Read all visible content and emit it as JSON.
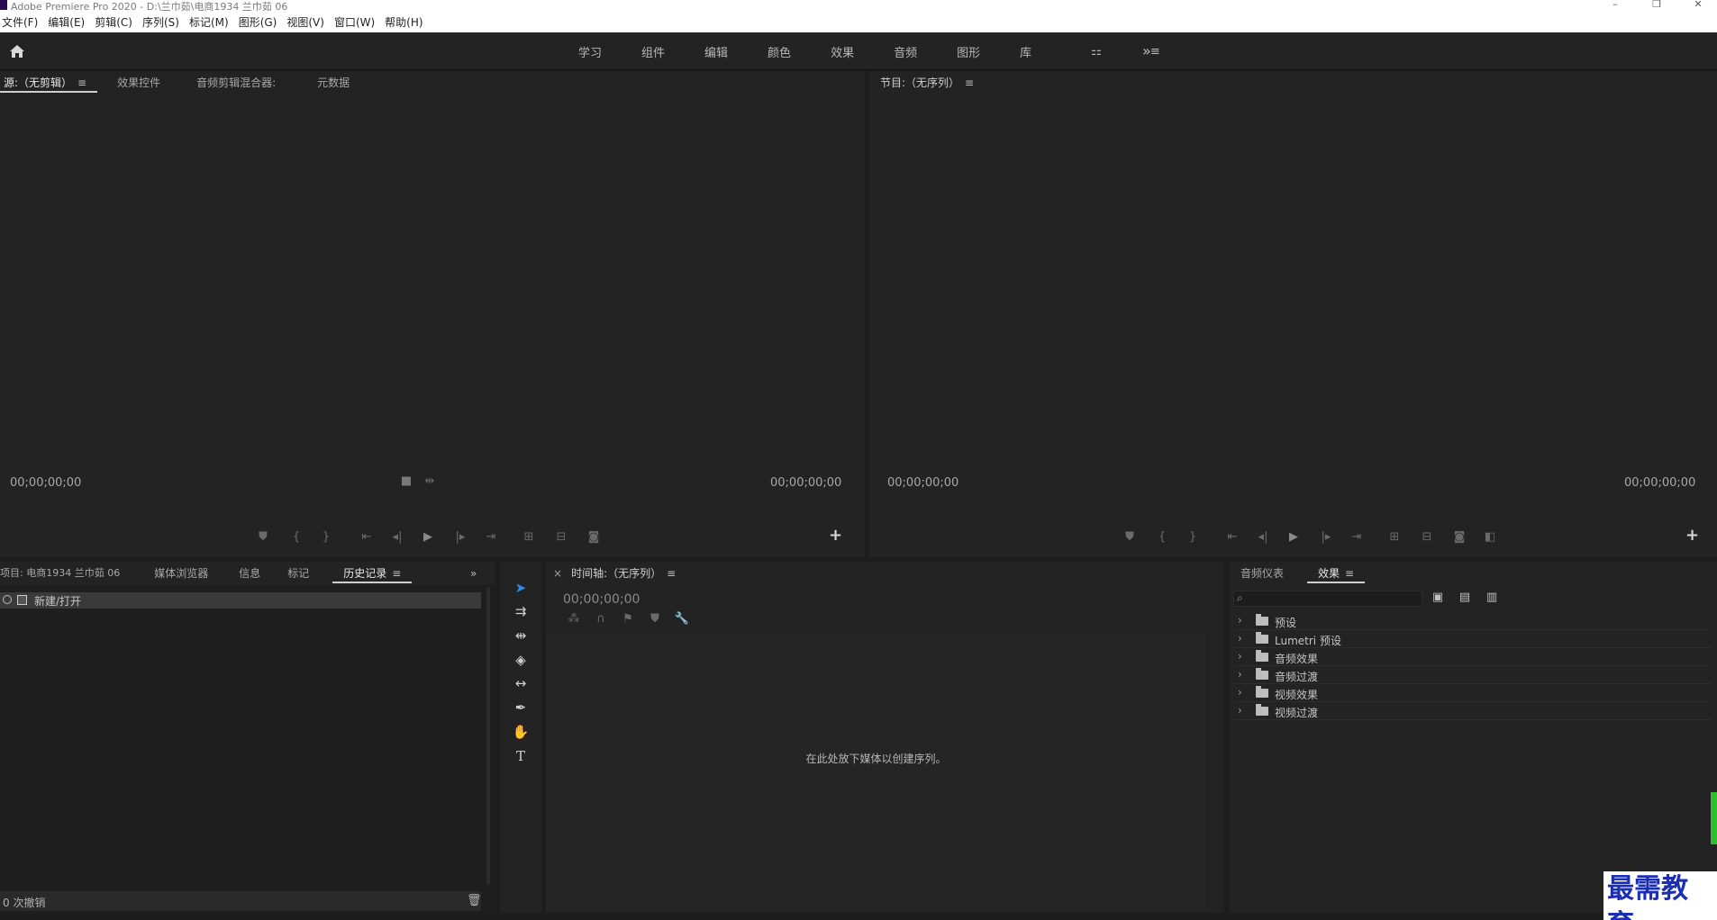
{
  "window": {
    "title": "Adobe Premiere Pro 2020 - D:\\兰巾茹\\电商1934 兰巾茹 06",
    "controls": [
      "–",
      "❐",
      "✕"
    ]
  },
  "menu": [
    "文件(F)",
    "编辑(E)",
    "剪辑(C)",
    "序列(S)",
    "标记(M)",
    "图形(G)",
    "视图(V)",
    "窗口(W)",
    "帮助(H)"
  ],
  "workspaces": {
    "tabs": [
      "学习",
      "组件",
      "编辑",
      "颜色",
      "效果",
      "音频",
      "图形",
      "库"
    ],
    "active_label": "≡",
    "more": "»"
  },
  "source_panel": {
    "tabs": [
      "源:（无剪辑）",
      "效果控件",
      "音频剪辑混合器:",
      "元数据"
    ],
    "timecode_left": "00;00;00;00",
    "timecode_right": "00;00;00;00"
  },
  "program_panel": {
    "tab": "节目:（无序列）",
    "timecode_left": "00;00;00;00",
    "timecode_right": "00;00;00;00"
  },
  "project_panel": {
    "tabs": [
      "项目: 电商1934 兰巾茹 06",
      "媒体浏览器",
      "信息",
      "标记",
      "历史记录"
    ],
    "history_item": "新建/打开",
    "footer": "0 次撤销"
  },
  "timeline_panel": {
    "tab": "时间轴:（无序列）",
    "timecode": "00;00;00;00",
    "empty_message": "在此处放下媒体以创建序列。"
  },
  "effects_panel": {
    "tabs": [
      "音频仪表",
      "效果"
    ],
    "search_placeholder": "",
    "items": [
      "预设",
      "Lumetri 预设",
      "音频效果",
      "音频过渡",
      "视频效果",
      "视频过渡"
    ]
  },
  "watermark": "最需教育",
  "colors": {
    "accent": "#2d8ceb",
    "panel": "#232323",
    "bg": "#1d1d1d"
  }
}
